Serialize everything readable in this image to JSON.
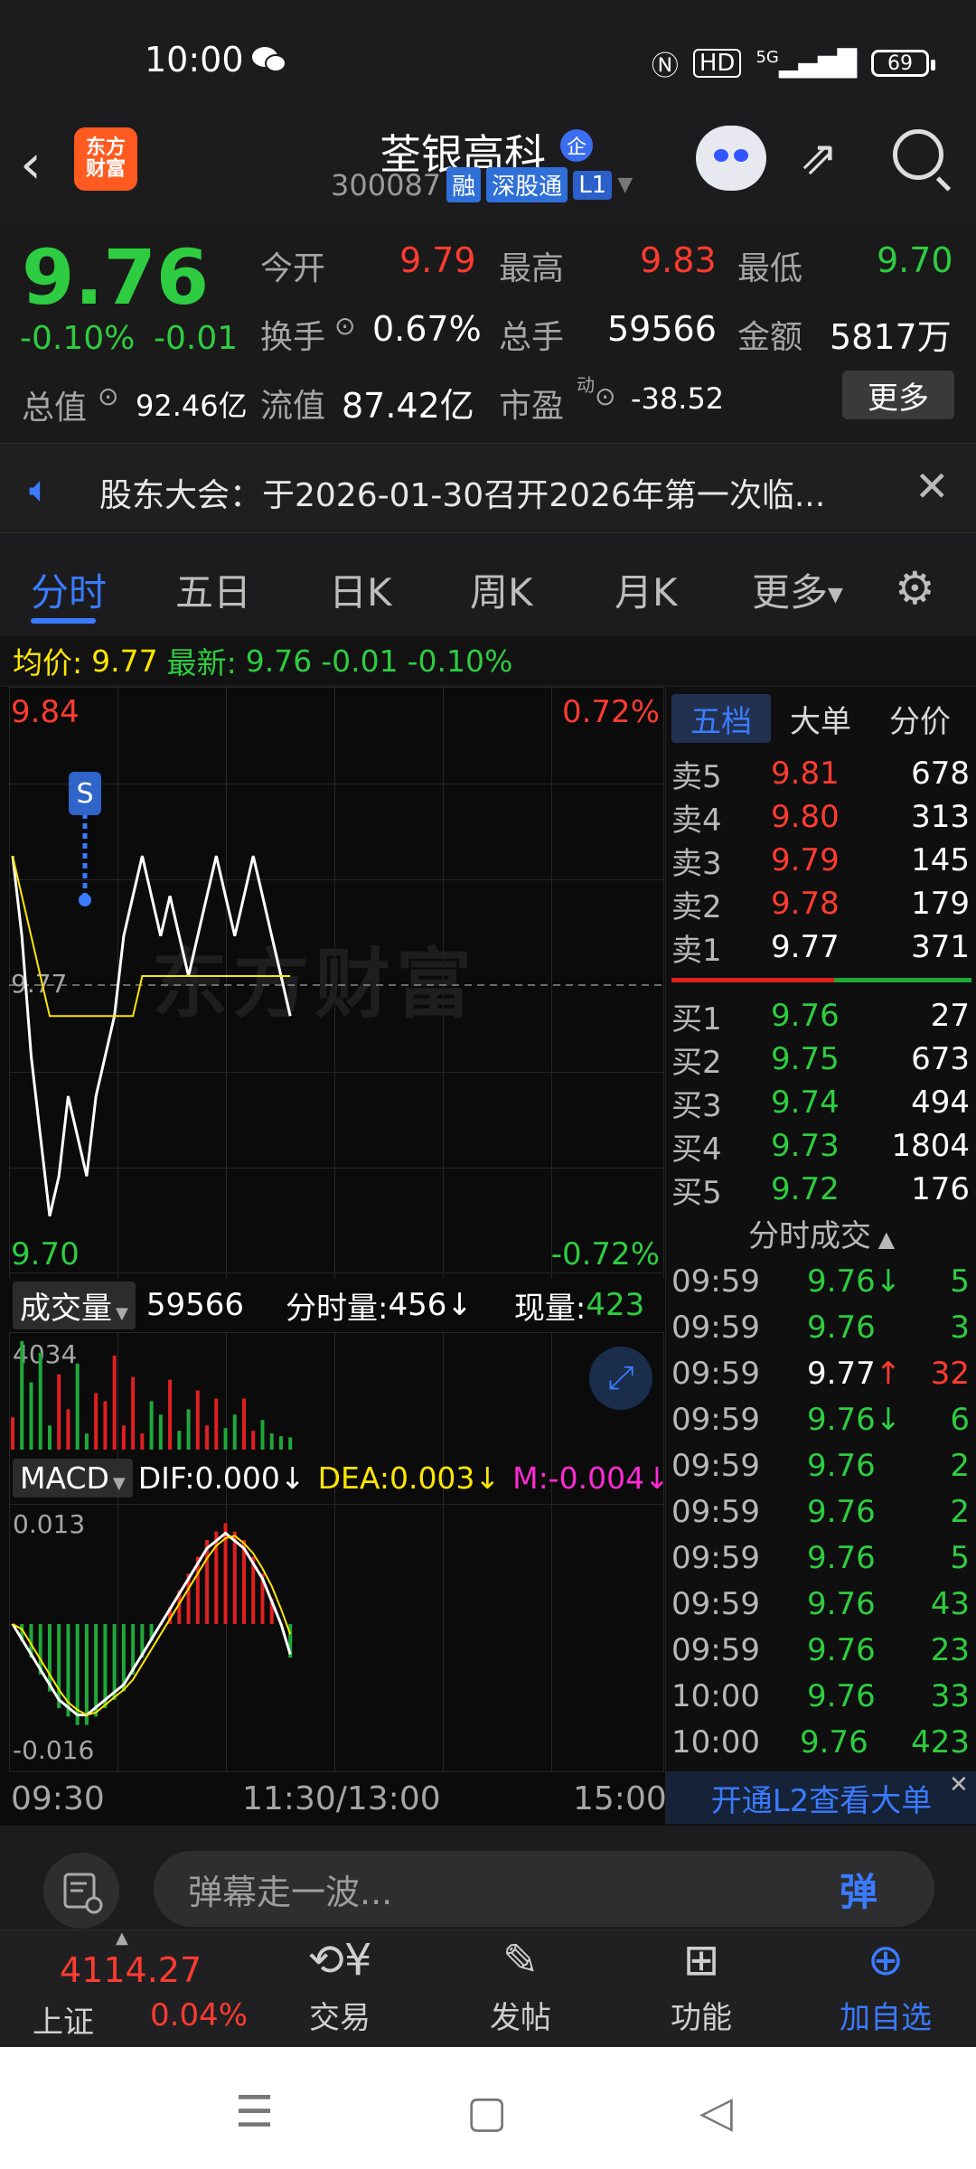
{
  "status_bar": {
    "time": "10:00",
    "battery": "69",
    "hd": "HD",
    "net": "5G"
  },
  "header": {
    "logo_text": "东方\n财富",
    "name": "荃银高科",
    "qi_badge": "企",
    "code": "300087",
    "tags": [
      "融",
      "深股通",
      "L1"
    ]
  },
  "quote": {
    "price": "9.76",
    "change_pct": "-0.10%",
    "change": "-0.01",
    "open_label": "今开",
    "open": "9.79",
    "high_label": "最高",
    "high": "9.83",
    "low_label": "最低",
    "low": "9.70",
    "turnover_label": "换手",
    "turnover": "0.67%",
    "volume_label": "总手",
    "volume": "59566",
    "amount_label": "金额",
    "amount": "5817万",
    "mktcap_label": "总值",
    "mktcap": "92.46亿",
    "float_label": "流值",
    "float": "87.42亿",
    "pe_label": "市盈",
    "pe_sup": "动",
    "pe": "-38.52",
    "more": "更多"
  },
  "notice": {
    "text": "股东大会：于2026-01-30召开2026年第一次临..."
  },
  "tabs": [
    "分时",
    "五日",
    "日K",
    "周K",
    "月K",
    "更多"
  ],
  "avg_bar": {
    "avg_label": "均价:",
    "avg": "9.77",
    "latest_label": "最新:",
    "latest": "9.76",
    "chg": "-0.01",
    "pct": "-0.10%"
  },
  "chart": {
    "top_price": "9.84",
    "top_pct": "0.72%",
    "bottom_price": "9.70",
    "bottom_pct": "-0.72%",
    "mid_label": "9.77",
    "watermark": "东方财富",
    "vol_label": "成交量",
    "vol_total": "59566",
    "vol_min_label": "分时量:",
    "vol_min": "456",
    "vol_now_label": "现量:",
    "vol_now": "423",
    "vol_max": "4034",
    "macd_label": "MACD",
    "dif": "DIF:0.000",
    "dea": "DEA:0.003",
    "m": "M:-0.004",
    "macd_top": "0.013",
    "macd_bottom": "-0.016",
    "time_start": "09:30",
    "time_mid": "11:30/13:00",
    "time_end": "15:00"
  },
  "chart_data": {
    "type": "line",
    "title": "",
    "xlabel": "",
    "ylabel": "",
    "ylim": [
      9.7,
      9.84
    ],
    "x": [
      0,
      1,
      2,
      3,
      4,
      5,
      6,
      7,
      8,
      9,
      10,
      11,
      12,
      13,
      14,
      15,
      16,
      17,
      18,
      19,
      20,
      21,
      22,
      23,
      24,
      25,
      26,
      27,
      28,
      29,
      30
    ],
    "series": [
      {
        "values": [
          9.8,
          9.78,
          9.75,
          9.73,
          9.71,
          9.72,
          9.74,
          9.73,
          9.72,
          9.74,
          9.75,
          9.76,
          9.78,
          9.79,
          9.8,
          9.79,
          9.78,
          9.79,
          9.78,
          9.77,
          9.78,
          9.79,
          9.8,
          9.79,
          9.78,
          9.79,
          9.8,
          9.79,
          9.78,
          9.77,
          9.76
        ]
      },
      {
        "values": [
          9.8,
          9.79,
          9.78,
          9.77,
          9.76,
          9.76,
          9.76,
          9.76,
          9.76,
          9.76,
          9.76,
          9.76,
          9.76,
          9.76,
          9.77,
          9.77,
          9.77,
          9.77,
          9.77,
          9.77,
          9.77,
          9.77,
          9.77,
          9.77,
          9.77,
          9.77,
          9.77,
          9.77,
          9.77,
          9.77,
          9.77
        ]
      }
    ],
    "volume": [
      1200,
      4034,
      2500,
      3600,
      900,
      2800,
      1500,
      3200,
      600,
      2100,
      1800,
      3500,
      900,
      2700,
      600,
      1800,
      1300,
      2600,
      700,
      1500,
      2200,
      900,
      1900,
      800,
      1300,
      1900,
      700,
      1100,
      600,
      500,
      456
    ],
    "macd_ylim": [
      -0.016,
      0.013
    ],
    "macd": [
      0.0,
      -0.002,
      -0.004,
      -0.006,
      -0.008,
      -0.01,
      -0.011,
      -0.012,
      -0.012,
      -0.011,
      -0.01,
      -0.009,
      -0.008,
      -0.006,
      -0.004,
      -0.002,
      0.0,
      0.002,
      0.004,
      0.006,
      0.008,
      0.01,
      0.011,
      0.012,
      0.011,
      0.01,
      0.008,
      0.006,
      0.003,
      0.0,
      -0.004
    ]
  },
  "book": {
    "tabs": [
      "五档",
      "大单",
      "分价"
    ],
    "asks": [
      {
        "label": "卖5",
        "price": "9.81",
        "vol": "678"
      },
      {
        "label": "卖4",
        "price": "9.80",
        "vol": "313"
      },
      {
        "label": "卖3",
        "price": "9.79",
        "vol": "145"
      },
      {
        "label": "卖2",
        "price": "9.78",
        "vol": "179"
      },
      {
        "label": "卖1",
        "price": "9.77",
        "vol": "371"
      }
    ],
    "bids": [
      {
        "label": "买1",
        "price": "9.76",
        "vol": "27"
      },
      {
        "label": "买2",
        "price": "9.75",
        "vol": "673"
      },
      {
        "label": "买3",
        "price": "9.74",
        "vol": "494"
      },
      {
        "label": "买4",
        "price": "9.73",
        "vol": "1804"
      },
      {
        "label": "买5",
        "price": "9.72",
        "vol": "176"
      }
    ],
    "trades_title": "分时成交",
    "trades": [
      {
        "t": "09:59",
        "p": "9.76",
        "a": "↓",
        "v": "5",
        "pc": "green",
        "vc": "green"
      },
      {
        "t": "09:59",
        "p": "9.76",
        "a": "",
        "v": "3",
        "pc": "green",
        "vc": "green"
      },
      {
        "t": "09:59",
        "p": "9.77",
        "a": "↑",
        "v": "32",
        "pc": "white",
        "vc": "red"
      },
      {
        "t": "09:59",
        "p": "9.76",
        "a": "↓",
        "v": "6",
        "pc": "green",
        "vc": "green"
      },
      {
        "t": "09:59",
        "p": "9.76",
        "a": "",
        "v": "2",
        "pc": "green",
        "vc": "green"
      },
      {
        "t": "09:59",
        "p": "9.76",
        "a": "",
        "v": "2",
        "pc": "green",
        "vc": "green"
      },
      {
        "t": "09:59",
        "p": "9.76",
        "a": "",
        "v": "5",
        "pc": "green",
        "vc": "green"
      },
      {
        "t": "09:59",
        "p": "9.76",
        "a": "",
        "v": "43",
        "pc": "green",
        "vc": "green"
      },
      {
        "t": "09:59",
        "p": "9.76",
        "a": "",
        "v": "23",
        "pc": "green",
        "vc": "green"
      },
      {
        "t": "10:00",
        "p": "9.76",
        "a": "",
        "v": "33",
        "pc": "green",
        "vc": "green"
      },
      {
        "t": "10:00",
        "p": "9.76",
        "a": "",
        "v": "423",
        "pc": "green",
        "vc": "green"
      }
    ],
    "l2_link": "开通L2查看大单"
  },
  "comment": {
    "placeholder": "弹幕走一波...",
    "dan": "弹"
  },
  "bottom_nav": {
    "index_value": "4114.27",
    "index_name": "上证",
    "index_change": "0.04%",
    "items": [
      "交易",
      "发帖",
      "功能",
      "加自选"
    ]
  }
}
